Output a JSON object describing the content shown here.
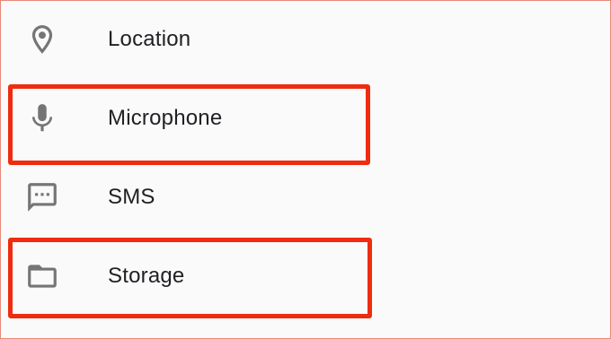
{
  "permissions": {
    "items": [
      {
        "label": "Location",
        "icon": "location-pin-icon"
      },
      {
        "label": "Microphone",
        "icon": "microphone-icon"
      },
      {
        "label": "SMS",
        "icon": "sms-message-icon"
      },
      {
        "label": "Storage",
        "icon": "folder-icon"
      }
    ]
  },
  "colors": {
    "highlight_border": "#ee2c0f",
    "icon": "#757575",
    "text": "#202124",
    "frame_border": "#e58a7a",
    "background": "#fafafa"
  }
}
